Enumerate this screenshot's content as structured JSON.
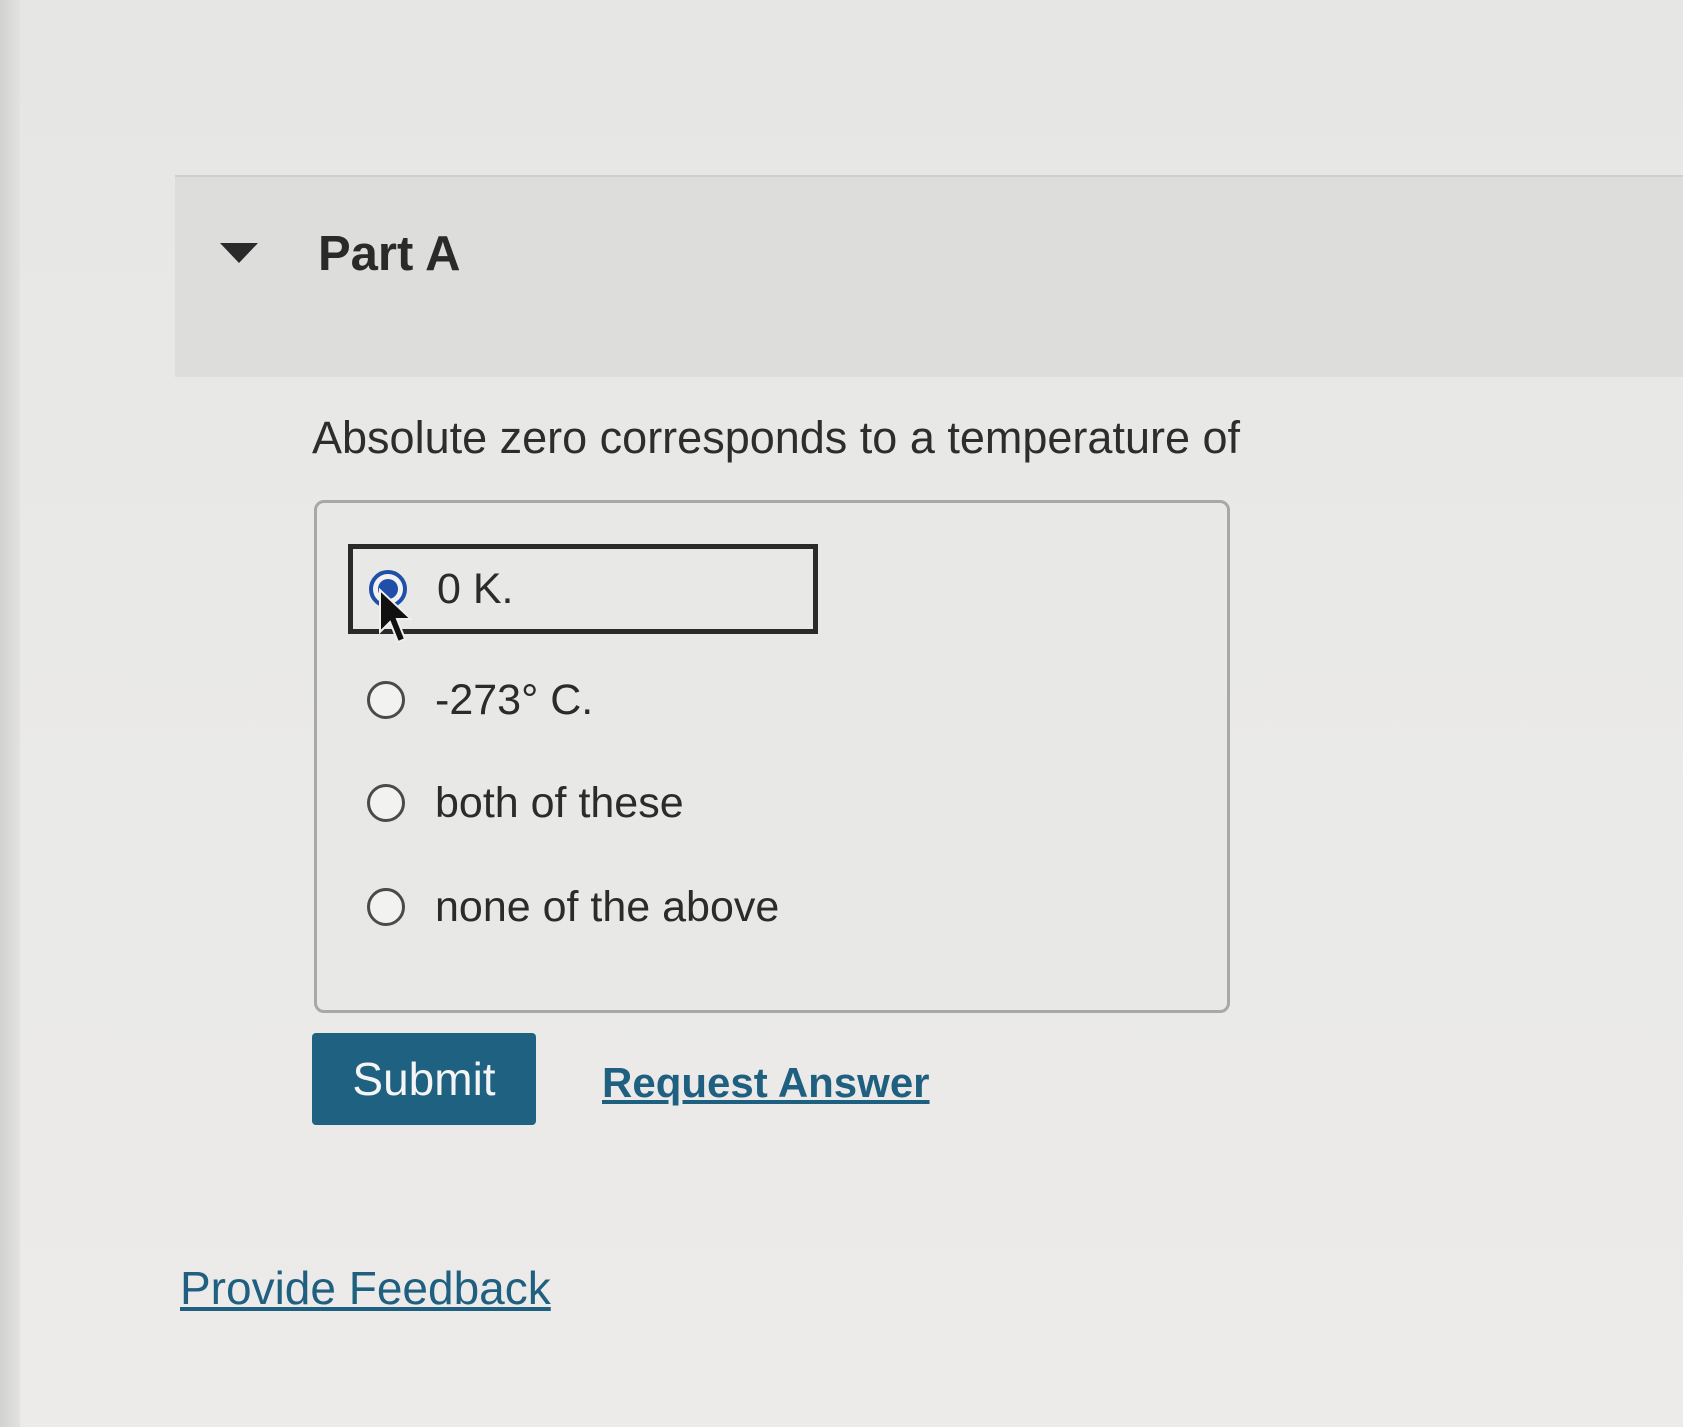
{
  "part": {
    "title": "Part A"
  },
  "question": {
    "text": "Absolute zero corresponds to a temperature of"
  },
  "options": [
    {
      "label": "0 K.",
      "selected": true
    },
    {
      "label": "-273° C.",
      "selected": false
    },
    {
      "label": "both of these",
      "selected": false
    },
    {
      "label": "none of the above",
      "selected": false
    }
  ],
  "actions": {
    "submit_label": "Submit",
    "request_answer_label": "Request Answer"
  },
  "footer": {
    "feedback_label": "Provide Feedback"
  },
  "colors": {
    "accent": "#1f6181",
    "link": "#1f5f80",
    "radio_selected": "#1f4fa8"
  }
}
